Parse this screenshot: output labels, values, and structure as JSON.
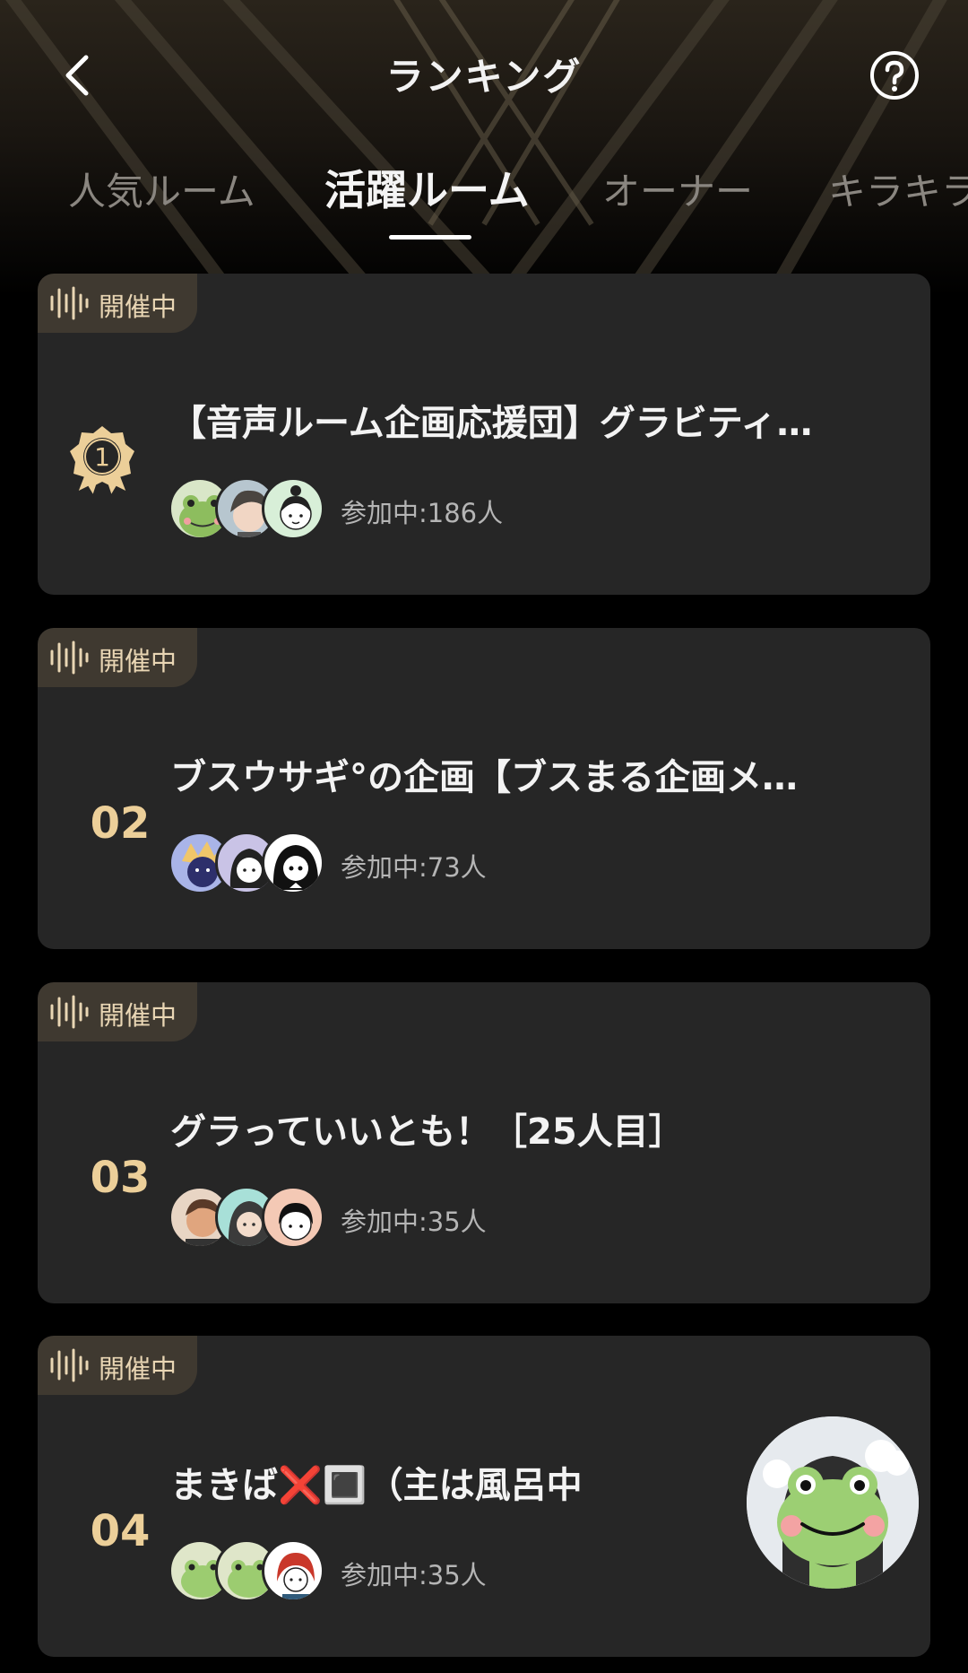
{
  "header": {
    "title": "ランキング",
    "back_icon": "chevron-left-icon",
    "help_icon": "question-circle-icon"
  },
  "tabs": [
    {
      "label": "人気ルーム",
      "active": false
    },
    {
      "label": "活躍ルーム",
      "active": true
    },
    {
      "label": "オーナー",
      "active": false
    },
    {
      "label": "キラキラ",
      "active": false
    }
  ],
  "rooms": [
    {
      "status": "開催中",
      "rank": "1",
      "title": "【音声ルーム企画応援団】グラビティ…",
      "count": "参加中:186人"
    },
    {
      "status": "開催中",
      "rank": "02",
      "title": "ブスウサギ°の企画【ブスまる企画メ…",
      "count": "参加中:73人"
    },
    {
      "status": "開催中",
      "rank": "03",
      "title": "グラっていいとも！［25人目］",
      "count": "参加中:35人"
    },
    {
      "status": "開催中",
      "rank": "04",
      "title": "まきば❌🔳（主は風呂中",
      "count": "参加中:35人"
    }
  ],
  "colors": {
    "background": "#000000",
    "card": "#262626",
    "badge": "#3f3930",
    "accent_gold": "#eccf99"
  }
}
